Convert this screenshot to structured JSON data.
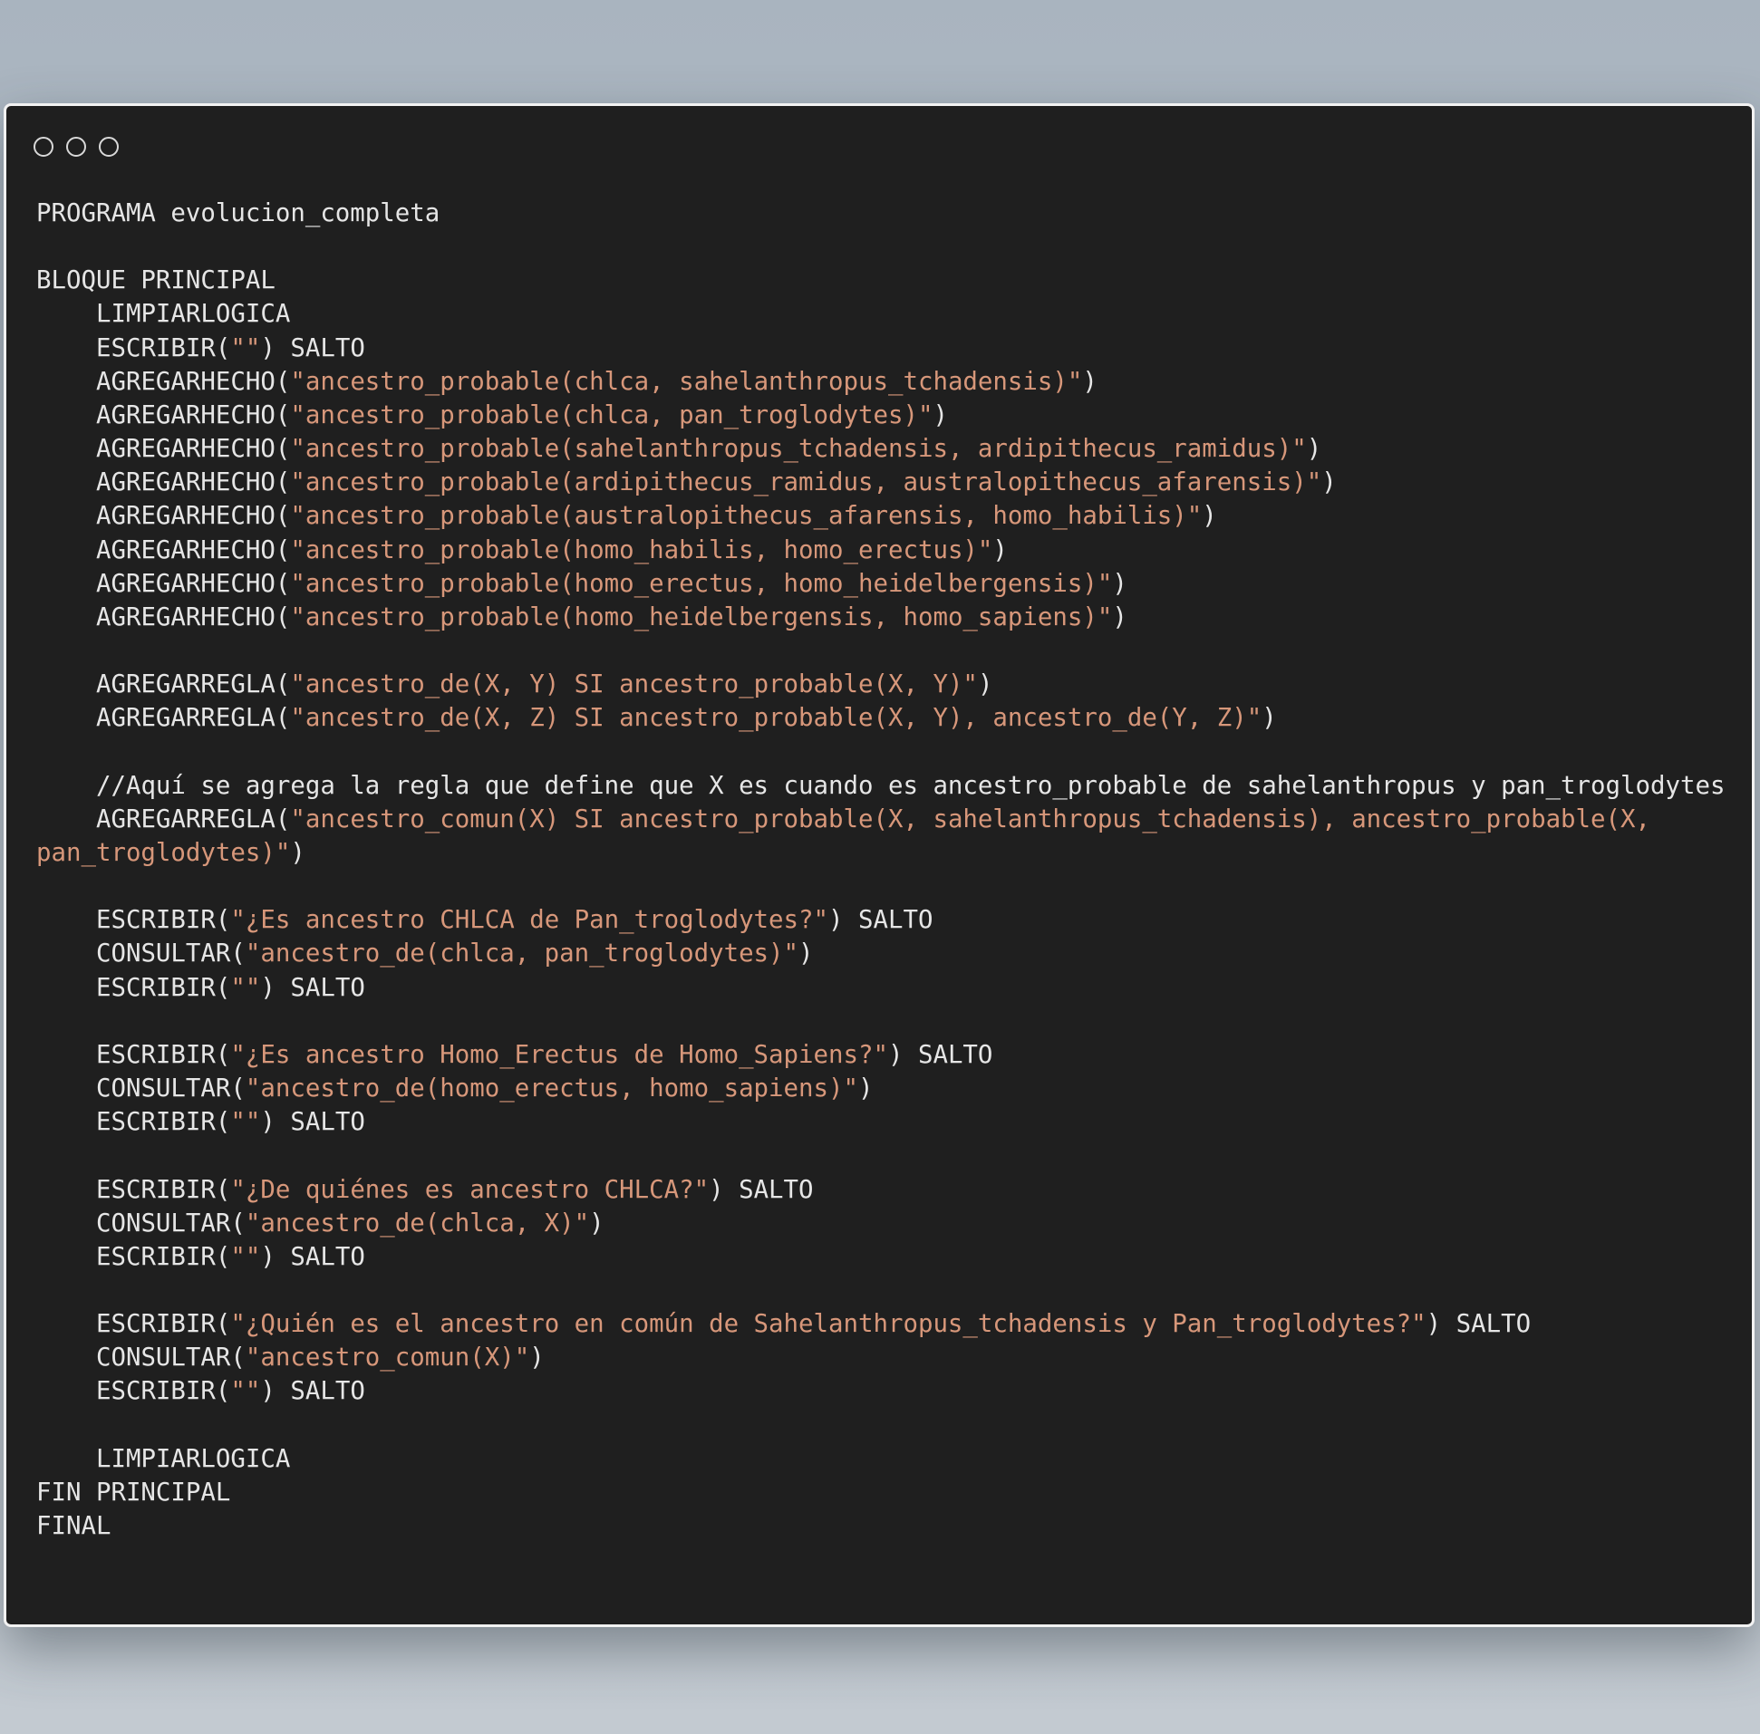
{
  "window": {
    "controls": [
      "window-control-1",
      "window-control-2",
      "window-control-3"
    ]
  },
  "colors": {
    "background": "#1f1f1f",
    "text": "#e6e6e6",
    "string": "#d7977a",
    "page_background": "#b3bdc7"
  },
  "code": {
    "lines": [
      [
        {
          "t": "PROGRAMA evolucion_completa"
        }
      ],
      [],
      [
        {
          "t": "BLOQUE PRINCIPAL"
        }
      ],
      [
        {
          "t": "    LIMPIARLOGICA"
        }
      ],
      [
        {
          "t": "    ESCRIBIR("
        },
        {
          "t": "\"\"",
          "s": true
        },
        {
          "t": ") SALTO"
        }
      ],
      [
        {
          "t": "    AGREGARHECHO("
        },
        {
          "t": "\"ancestro_probable(chlca, sahelanthropus_tchadensis)\"",
          "s": true
        },
        {
          "t": ")"
        }
      ],
      [
        {
          "t": "    AGREGARHECHO("
        },
        {
          "t": "\"ancestro_probable(chlca, pan_troglodytes)\"",
          "s": true
        },
        {
          "t": ")"
        }
      ],
      [
        {
          "t": "    AGREGARHECHO("
        },
        {
          "t": "\"ancestro_probable(sahelanthropus_tchadensis, ardipithecus_ramidus)\"",
          "s": true
        },
        {
          "t": ")"
        }
      ],
      [
        {
          "t": "    AGREGARHECHO("
        },
        {
          "t": "\"ancestro_probable(ardipithecus_ramidus, australopithecus_afarensis)\"",
          "s": true
        },
        {
          "t": ")"
        }
      ],
      [
        {
          "t": "    AGREGARHECHO("
        },
        {
          "t": "\"ancestro_probable(australopithecus_afarensis, homo_habilis)\"",
          "s": true
        },
        {
          "t": ")"
        }
      ],
      [
        {
          "t": "    AGREGARHECHO("
        },
        {
          "t": "\"ancestro_probable(homo_habilis, homo_erectus)\"",
          "s": true
        },
        {
          "t": ")"
        }
      ],
      [
        {
          "t": "    AGREGARHECHO("
        },
        {
          "t": "\"ancestro_probable(homo_erectus, homo_heidelbergensis)\"",
          "s": true
        },
        {
          "t": ")"
        }
      ],
      [
        {
          "t": "    AGREGARHECHO("
        },
        {
          "t": "\"ancestro_probable(homo_heidelbergensis, homo_sapiens)\"",
          "s": true
        },
        {
          "t": ")"
        }
      ],
      [],
      [
        {
          "t": "    AGREGARREGLA("
        },
        {
          "t": "\"ancestro_de(X, Y) SI ancestro_probable(X, Y)\"",
          "s": true
        },
        {
          "t": ")"
        }
      ],
      [
        {
          "t": "    AGREGARREGLA("
        },
        {
          "t": "\"ancestro_de(X, Z) SI ancestro_probable(X, Y), ancestro_de(Y, Z)\"",
          "s": true
        },
        {
          "t": ")"
        }
      ],
      [],
      [
        {
          "t": "    //Aquí se agrega la regla que define que X es cuando es ancestro_probable de sahelanthropus y pan_troglodytes"
        }
      ],
      [
        {
          "t": "    AGREGARREGLA("
        },
        {
          "t": "\"ancestro_comun(X) SI ancestro_probable(X, sahelanthropus_tchadensis), ancestro_probable(X, pan_troglodytes)\"",
          "s": true
        },
        {
          "t": ")"
        }
      ],
      [],
      [
        {
          "t": "    ESCRIBIR("
        },
        {
          "t": "\"¿Es ancestro CHLCA de Pan_troglodytes?\"",
          "s": true
        },
        {
          "t": ") SALTO"
        }
      ],
      [
        {
          "t": "    CONSULTAR("
        },
        {
          "t": "\"ancestro_de(chlca, pan_troglodytes)\"",
          "s": true
        },
        {
          "t": ")"
        }
      ],
      [
        {
          "t": "    ESCRIBIR("
        },
        {
          "t": "\"\"",
          "s": true
        },
        {
          "t": ") SALTO"
        }
      ],
      [],
      [
        {
          "t": "    ESCRIBIR("
        },
        {
          "t": "\"¿Es ancestro Homo_Erectus de Homo_Sapiens?\"",
          "s": true
        },
        {
          "t": ") SALTO"
        }
      ],
      [
        {
          "t": "    CONSULTAR("
        },
        {
          "t": "\"ancestro_de(homo_erectus, homo_sapiens)\"",
          "s": true
        },
        {
          "t": ")"
        }
      ],
      [
        {
          "t": "    ESCRIBIR("
        },
        {
          "t": "\"\"",
          "s": true
        },
        {
          "t": ") SALTO"
        }
      ],
      [],
      [
        {
          "t": "    ESCRIBIR("
        },
        {
          "t": "\"¿De quiénes es ancestro CHLCA?\"",
          "s": true
        },
        {
          "t": ") SALTO"
        }
      ],
      [
        {
          "t": "    CONSULTAR("
        },
        {
          "t": "\"ancestro_de(chlca, X)\"",
          "s": true
        },
        {
          "t": ")"
        }
      ],
      [
        {
          "t": "    ESCRIBIR("
        },
        {
          "t": "\"\"",
          "s": true
        },
        {
          "t": ") SALTO"
        }
      ],
      [],
      [
        {
          "t": "    ESCRIBIR("
        },
        {
          "t": "\"¿Quién es el ancestro en común de Sahelanthropus_tchadensis y Pan_troglodytes?\"",
          "s": true
        },
        {
          "t": ") SALTO"
        }
      ],
      [
        {
          "t": "    CONSULTAR("
        },
        {
          "t": "\"ancestro_comun(X)\"",
          "s": true
        },
        {
          "t": ")"
        }
      ],
      [
        {
          "t": "    ESCRIBIR("
        },
        {
          "t": "\"\"",
          "s": true
        },
        {
          "t": ") SALTO"
        }
      ],
      [],
      [
        {
          "t": "    LIMPIARLOGICA"
        }
      ],
      [
        {
          "t": "FIN PRINCIPAL"
        }
      ],
      [
        {
          "t": "FINAL"
        }
      ]
    ]
  }
}
